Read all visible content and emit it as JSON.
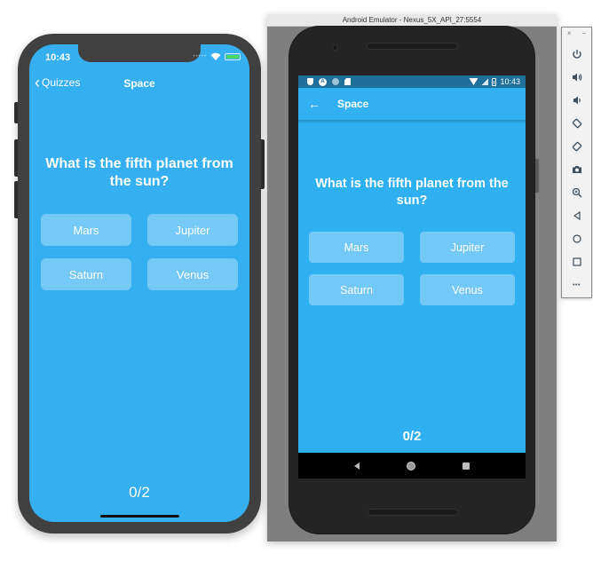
{
  "ios": {
    "status": {
      "time": "10:43"
    },
    "nav": {
      "back_label": "Quizzes",
      "title": "Space"
    },
    "question": "What is the fifth planet from the sun?",
    "answers": [
      "Mars",
      "Jupiter",
      "Saturn",
      "Venus"
    ],
    "score": "0/2"
  },
  "android": {
    "window_title": "Android Emulator - Nexus_5X_API_27:5554",
    "status": {
      "time": "10:43"
    },
    "appbar": {
      "back_icon": "←",
      "title": "Space"
    },
    "question": "What is the fifth planet from the sun?",
    "answers": [
      "Mars",
      "Jupiter",
      "Saturn",
      "Venus"
    ],
    "score": "0/2"
  },
  "toolbar": {
    "close": "×",
    "minimize": "−",
    "items": [
      "power",
      "volume-up",
      "volume-down",
      "rotate-left",
      "rotate-right",
      "screenshot",
      "zoom",
      "back",
      "home",
      "overview",
      "more"
    ],
    "more_label": "•••"
  },
  "colors": {
    "app_blue": "#35aff0",
    "answer_button": "#74c9f6",
    "android_status_bar": "#1e6f99"
  }
}
